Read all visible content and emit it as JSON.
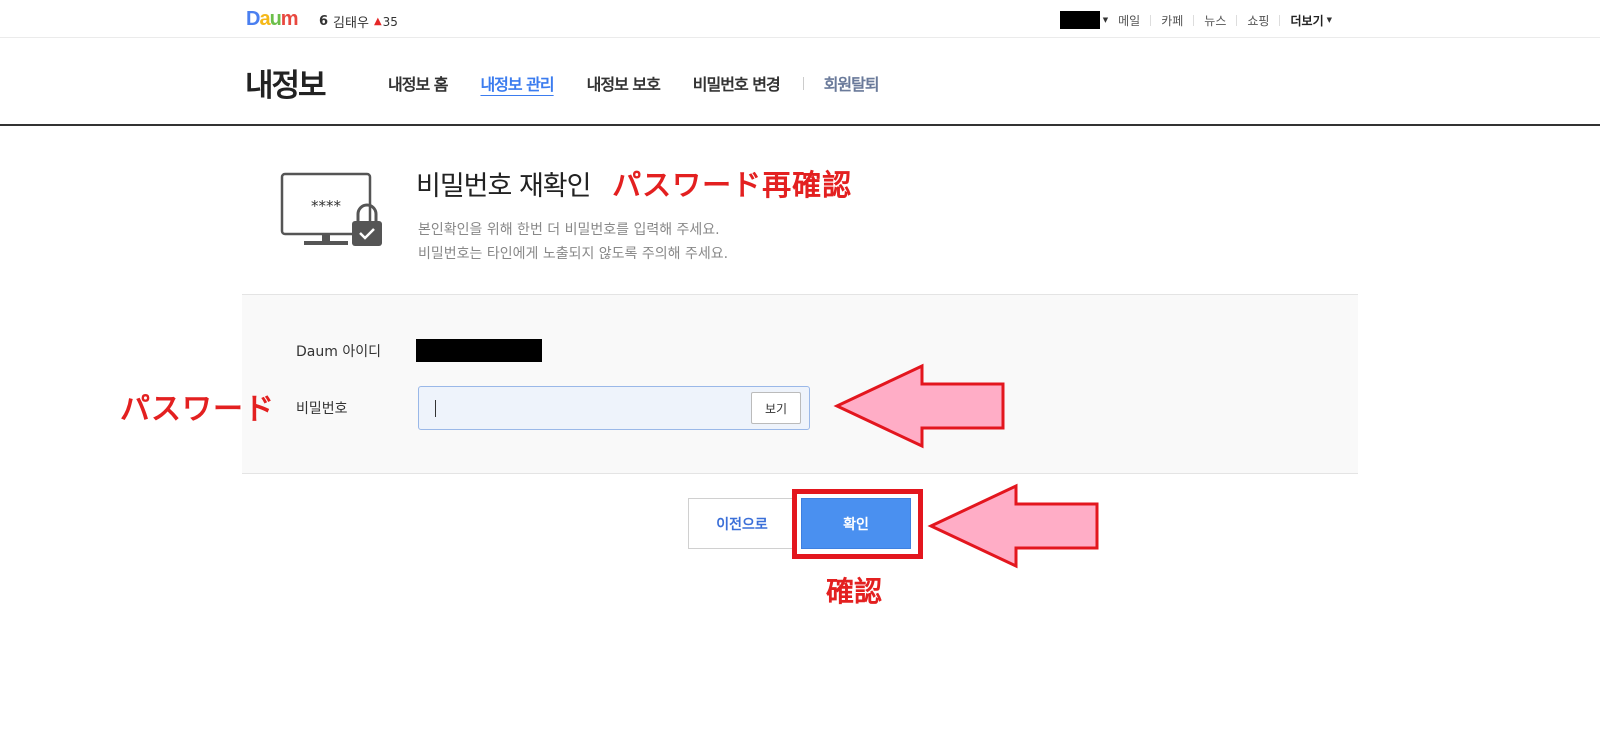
{
  "topbar": {
    "logo": "Daum",
    "rank": {
      "position": "6",
      "name": "김태우",
      "change": "35"
    },
    "nav": [
      "메일",
      "카페",
      "뉴스",
      "쇼핑"
    ],
    "more": "더보기"
  },
  "header": {
    "title": "내정보",
    "tabs": [
      {
        "label": "내정보 홈",
        "active": false
      },
      {
        "label": "내정보 관리",
        "active": true
      },
      {
        "label": "내정보 보호",
        "active": false
      },
      {
        "label": "비밀번호 변경",
        "active": false
      }
    ],
    "leave": "회원탈퇴"
  },
  "intro": {
    "heading": "비밀번호 재확인",
    "heading_jp": "パスワード再確認",
    "monitor_text": "****",
    "desc1": "본인확인을 위해 한번 더 비밀번호를 입력해 주세요.",
    "desc2": "비밀번호는 타인에게 노출되지 않도록 주의해 주세요."
  },
  "form": {
    "id_label": "Daum 아이디",
    "pw_label": "비밀번호",
    "pw_label_jp": "パスワード",
    "show_button": "보기",
    "pw_value": ""
  },
  "buttons": {
    "prev": "이전으로",
    "ok": "확인",
    "ok_jp": "確認"
  },
  "colors": {
    "accent": "#3b7cef",
    "annotation_red": "#e3161e",
    "annotation_arrow_fill": "#ffadc6"
  }
}
